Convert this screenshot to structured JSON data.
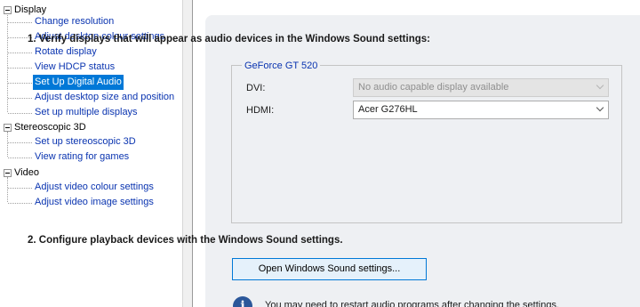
{
  "tree": {
    "groups": [
      {
        "label": "Display",
        "items": [
          "Change resolution",
          "Adjust desktop colour settings",
          "Rotate display",
          "View HDCP status",
          "Set Up Digital Audio",
          "Adjust desktop size and position",
          "Set up multiple displays"
        ]
      },
      {
        "label": "Stereoscopic 3D",
        "items": [
          "Set up stereoscopic 3D",
          "View rating for games"
        ]
      },
      {
        "label": "Video",
        "items": [
          "Adjust video colour settings",
          "Adjust video image settings"
        ]
      }
    ],
    "selected_item": "Set Up Digital Audio"
  },
  "main": {
    "step1": "1. Verify displays that will appear as audio devices in the Windows Sound settings:",
    "gpu_name": "GeForce GT 520",
    "rows": [
      {
        "label": "DVI:",
        "value": "No audio capable display available",
        "disabled": true
      },
      {
        "label": "HDMI:",
        "value": "Acer G276HL",
        "disabled": false
      }
    ],
    "step2": "2. Configure playback devices with the Windows Sound settings.",
    "sound_button": "Open Windows Sound settings...",
    "info_text": "You may need to restart audio programs after changing the settings."
  },
  "icons": {
    "info": "info-icon",
    "tree_toggle": "minus-box-icon",
    "dropdown": "chevron-down-icon"
  },
  "colors": {
    "link": "#0a34b0",
    "selected": "#0078d7",
    "card_bg": "#eef0f3"
  }
}
